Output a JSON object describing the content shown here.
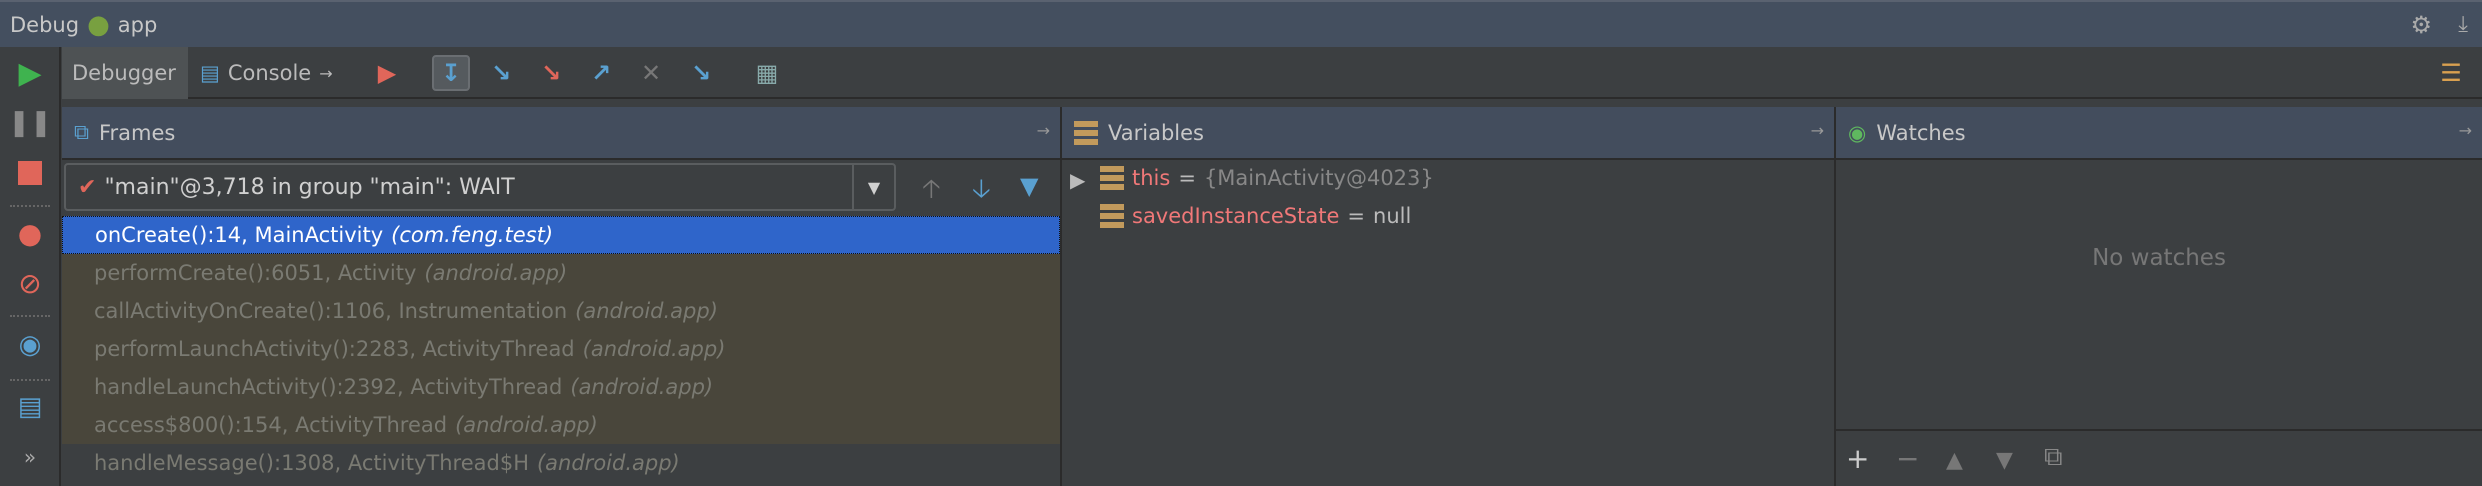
{
  "title": {
    "debug": "Debug",
    "app": "app"
  },
  "tabs": {
    "debugger": "Debugger",
    "console": "Console"
  },
  "frames": {
    "title": "Frames",
    "thread": "\"main\"@3,718 in group \"main\": WAIT",
    "rows": [
      {
        "method": "onCreate():14, MainActivity",
        "pkg": "(com.feng.test)"
      },
      {
        "method": "performCreate():6051, Activity",
        "pkg": "(android.app)"
      },
      {
        "method": "callActivityOnCreate():1106, Instrumentation",
        "pkg": "(android.app)"
      },
      {
        "method": "performLaunchActivity():2283, ActivityThread",
        "pkg": "(android.app)"
      },
      {
        "method": "handleLaunchActivity():2392, ActivityThread",
        "pkg": "(android.app)"
      },
      {
        "method": "access$800():154, ActivityThread",
        "pkg": "(android.app)"
      },
      {
        "method": "handleMessage():1308, ActivityThread$H",
        "pkg": "(android.app)"
      }
    ]
  },
  "variables": {
    "title": "Variables",
    "items": [
      {
        "name": "this",
        "eq": "=",
        "value": "{MainActivity@4023}"
      },
      {
        "name": "savedInstanceState",
        "eq": "=",
        "value": "null"
      }
    ]
  },
  "watches": {
    "title": "Watches",
    "empty": "No watches"
  },
  "colors": {
    "selection": "#2f65ca",
    "varName": "#f07878",
    "header": "#434d5d"
  }
}
